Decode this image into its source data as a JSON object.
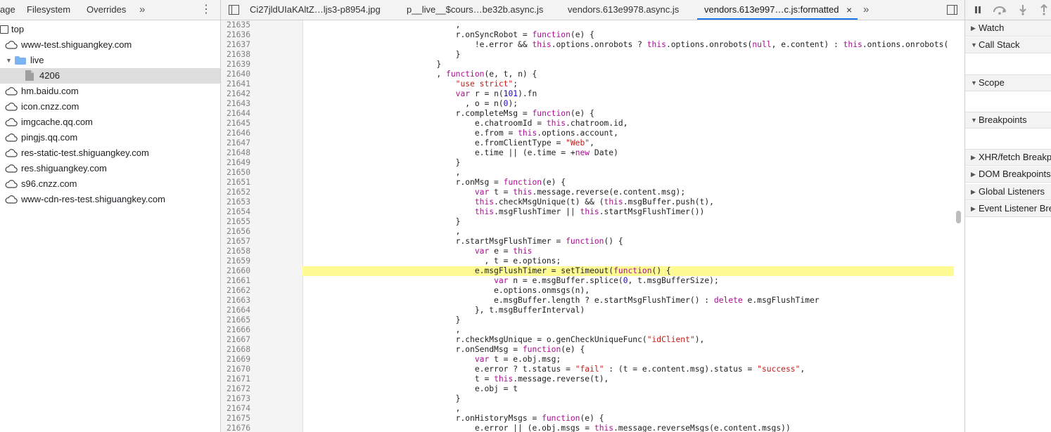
{
  "navigator": {
    "tabs": [
      "age",
      "Filesystem",
      "Overrides"
    ],
    "more": "»",
    "menu": "⋮",
    "tree": [
      {
        "label": "top"
      },
      {
        "label": "www-test.shiguangkey.com"
      },
      {
        "label": "live"
      },
      {
        "label": "4206"
      },
      {
        "label": "hm.baidu.com"
      },
      {
        "label": "icon.cnzz.com"
      },
      {
        "label": "imgcache.qq.com"
      },
      {
        "label": "pingjs.qq.com"
      },
      {
        "label": "res-static-test.shiguangkey.com"
      },
      {
        "label": "res.shiguangkey.com"
      },
      {
        "label": "s96.cnzz.com"
      },
      {
        "label": "www-cdn-res-test.shiguangkey.com"
      }
    ]
  },
  "editor": {
    "tabs": [
      {
        "label": "Ci27jldUIaKAltZ…ljs3-p8954.jpg"
      },
      {
        "label": "p__live__$cours…be32b.async.js"
      },
      {
        "label": "vendors.613e9978.async.js"
      },
      {
        "label": "vendors.613e997…c.js:formatted"
      }
    ],
    "close": "×",
    "more": "»",
    "highlight_line": "21660",
    "lines": [
      {
        "n": "21635",
        "html": "                                ,"
      },
      {
        "n": "21636",
        "html": "                                r.onSyncRobot = <span class=\"k\">function</span>(e) {"
      },
      {
        "n": "21637",
        "html": "                                    !e.error && <span class=\"k\">this</span>.options.onrobots ? <span class=\"k\">this</span>.options.onrobots(<span class=\"k\">null</span>, e.content) : <span class=\"k\">this</span>.ontions.onrobots("
      },
      {
        "n": "21638",
        "html": "                                }"
      },
      {
        "n": "21639",
        "html": "                            }"
      },
      {
        "n": "21640",
        "html": "                            , <span class=\"k\">function</span>(e, t, n) {"
      },
      {
        "n": "21641",
        "html": "                                <span class=\"s\">\"use strict\"</span>;"
      },
      {
        "n": "21642",
        "html": "                                <span class=\"k\">var</span> r = n(<span class=\"n\">101</span>).fn"
      },
      {
        "n": "21643",
        "html": "                                  , o = n(<span class=\"n\">0</span>);"
      },
      {
        "n": "21644",
        "html": "                                r.completeMsg = <span class=\"k\">function</span>(e) {"
      },
      {
        "n": "21645",
        "html": "                                    e.chatroomId = <span class=\"k\">this</span>.chatroom.id,"
      },
      {
        "n": "21646",
        "html": "                                    e.from = <span class=\"k\">this</span>.options.account,"
      },
      {
        "n": "21647",
        "html": "                                    e.fromClientType = <span class=\"s\">\"Web\"</span>,"
      },
      {
        "n": "21648",
        "html": "                                    e.time || (e.time = +<span class=\"k\">new</span> Date)"
      },
      {
        "n": "21649",
        "html": "                                }"
      },
      {
        "n": "21650",
        "html": "                                ,"
      },
      {
        "n": "21651",
        "html": "                                r.onMsg = <span class=\"k\">function</span>(e) {"
      },
      {
        "n": "21652",
        "html": "                                    <span class=\"k\">var</span> t = <span class=\"k\">this</span>.message.reverse(e.content.msg);"
      },
      {
        "n": "21653",
        "html": "                                    <span class=\"k\">this</span>.checkMsgUnique(t) && (<span class=\"k\">this</span>.msgBuffer.push(t),"
      },
      {
        "n": "21654",
        "html": "                                    <span class=\"k\">this</span>.msgFlushTimer || <span class=\"k\">this</span>.startMsgFlushTimer())"
      },
      {
        "n": "21655",
        "html": "                                }"
      },
      {
        "n": "21656",
        "html": "                                ,"
      },
      {
        "n": "21657",
        "html": "                                r.startMsgFlushTimer = <span class=\"k\">function</span>() {"
      },
      {
        "n": "21658",
        "html": "                                    <span class=\"k\">var</span> e = <span class=\"k\">this</span>"
      },
      {
        "n": "21659",
        "html": "                                      , t = e.options;"
      },
      {
        "n": "21660",
        "html": "                                    e.msgFlushTimer = setTimeout(<span class=\"k\">function</span>() {"
      },
      {
        "n": "21661",
        "html": "                                        <span class=\"k\">var</span> n = e.msgBuffer.splice(<span class=\"n\">0</span>, t.msgBufferSize);"
      },
      {
        "n": "21662",
        "html": "                                        e.options.onmsgs(n),"
      },
      {
        "n": "21663",
        "html": "                                        e.msgBuffer.length ? e.startMsgFlushTimer() : <span class=\"k\">delete</span> e.msgFlushTimer"
      },
      {
        "n": "21664",
        "html": "                                    }, t.msgBufferInterval)"
      },
      {
        "n": "21665",
        "html": "                                }"
      },
      {
        "n": "21666",
        "html": "                                ,"
      },
      {
        "n": "21667",
        "html": "                                r.checkMsgUnique = o.genCheckUniqueFunc(<span class=\"s\">\"idClient\"</span>),"
      },
      {
        "n": "21668",
        "html": "                                r.onSendMsg = <span class=\"k\">function</span>(e) {"
      },
      {
        "n": "21669",
        "html": "                                    <span class=\"k\">var</span> t = e.obj.msg;"
      },
      {
        "n": "21670",
        "html": "                                    e.error ? t.status = <span class=\"s\">\"fail\"</span> : (t = e.content.msg).status = <span class=\"s\">\"success\"</span>,"
      },
      {
        "n": "21671",
        "html": "                                    t = <span class=\"k\">this</span>.message.reverse(t),"
      },
      {
        "n": "21672",
        "html": "                                    e.obj = t"
      },
      {
        "n": "21673",
        "html": "                                }"
      },
      {
        "n": "21674",
        "html": "                                ,"
      },
      {
        "n": "21675",
        "html": "                                r.onHistoryMsgs = <span class=\"k\">function</span>(e) {"
      },
      {
        "n": "21676",
        "html": "                                    e.error || (e.obj.msgs = <span class=\"k\">this</span>.message.reverseMsgs(e.content.msgs))"
      }
    ]
  },
  "debugger": {
    "panes": [
      "Watch",
      "Call Stack",
      "Scope",
      "Breakpoints",
      "XHR/fetch Breakpoints",
      "DOM Breakpoints",
      "Global Listeners",
      "Event Listener Breakpoints"
    ]
  },
  "colors": {
    "highlight": "#fffb94",
    "keyword": "#aa0d91",
    "string": "#c41a16",
    "number": "#1c00cf",
    "active_tab_underline": "#1a73e8"
  }
}
